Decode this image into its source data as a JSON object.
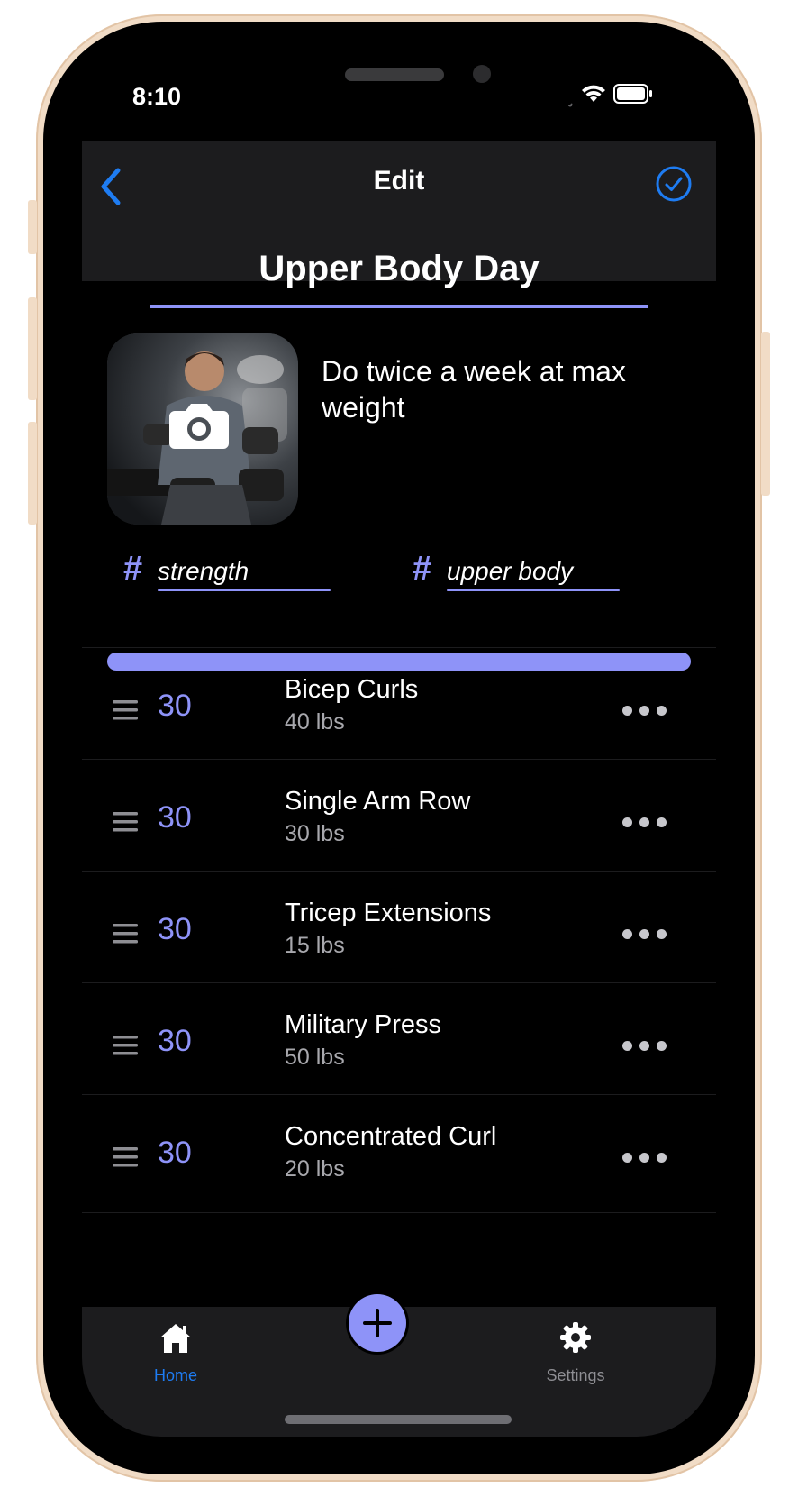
{
  "status_bar": {
    "time": "8:10"
  },
  "nav": {
    "title": "Edit"
  },
  "workout": {
    "title": "Upper Body Day",
    "description": "Do twice a week at max weight",
    "tags": [
      {
        "hash": "#",
        "label": "strength"
      },
      {
        "hash": "#",
        "label": "upper body"
      }
    ],
    "progress_percent": 100
  },
  "exercises": [
    {
      "reps": "30",
      "name": "Bicep Curls",
      "weight": "40 lbs"
    },
    {
      "reps": "30",
      "name": "Single Arm Row",
      "weight": "30 lbs"
    },
    {
      "reps": "30",
      "name": "Tricep Extensions",
      "weight": "15 lbs"
    },
    {
      "reps": "30",
      "name": "Military Press",
      "weight": "50 lbs"
    },
    {
      "reps": "30",
      "name": "Concentrated Curl",
      "weight": "20 lbs"
    }
  ],
  "tabbar": {
    "home_label": "Home",
    "settings_label": "Settings"
  },
  "colors": {
    "accent": "#8e93f8",
    "ios_blue": "#1e7cf2",
    "background": "#000000",
    "bar_background": "#1c1c1e",
    "muted_text": "#a8a8ad"
  },
  "icons": {
    "back": "chevron-left-icon",
    "done": "checkmark-circle-icon",
    "photo_overlay": "camera-icon",
    "drag": "drag-handle-icon",
    "more": "ellipsis-icon",
    "home": "house-icon",
    "add": "plus-icon",
    "settings": "gear-icon"
  }
}
